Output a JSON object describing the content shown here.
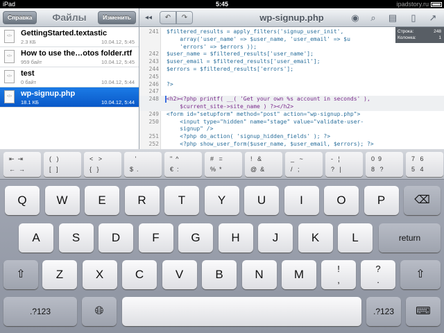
{
  "status": {
    "carrier": "iPad",
    "time": "5:45",
    "watermark": "ipadstory.ru"
  },
  "sidebar": {
    "left_button": "Справка",
    "title": "Файлы",
    "right_button": "Изменить",
    "files": [
      {
        "name": "GettingStarted.textastic",
        "size": "2.3 КБ",
        "date": "10.04.12, 5:45",
        "selected": false
      },
      {
        "name": "How to use the…otos folder.rtf",
        "size": "959 байт",
        "date": "10.04.12, 5:45",
        "selected": false
      },
      {
        "name": "test",
        "size": "0 байт",
        "date": "10.04.12, 5:44",
        "selected": false
      },
      {
        "name": "wp-signup.php",
        "size": "18.1 КБ",
        "date": "10.04.12, 5:44",
        "selected": true
      }
    ]
  },
  "editor": {
    "title": "wp-signup.php",
    "cursor_line_label": "Строка:",
    "cursor_line_value": "248",
    "cursor_col_label": "Колонка:",
    "cursor_col_value": "1",
    "lines": [
      {
        "n": "241",
        "text": "$filtered_results = apply_filters('signup_user_init',"
      },
      {
        "n": "",
        "text": "    array('user_name' => $user_name, 'user_email' => $u"
      },
      {
        "n": "",
        "text": "    'errors' => $errors ));"
      },
      {
        "n": "242",
        "text": "$user_name = $filtered_results['user_name'];"
      },
      {
        "n": "243",
        "text": "$user_email = $filtered_results['user_email'];"
      },
      {
        "n": "244",
        "text": "$errors = $filtered_results['errors'];"
      },
      {
        "n": "245",
        "text": ""
      },
      {
        "n": "246",
        "text": "?>"
      },
      {
        "n": "247",
        "text": ""
      },
      {
        "n": "248",
        "text": "<h2><?php printf( __( 'Get your own %s account in seconds' ),"
      },
      {
        "n": "",
        "text": "    $current_site->site_name ) ?></h2>"
      },
      {
        "n": "249",
        "text": "<form id=\"setupform\" method=\"post\" action=\"wp-signup.php\">"
      },
      {
        "n": "250",
        "text": "    <input type=\"hidden\" name=\"stage\" value=\"validate-user-"
      },
      {
        "n": "",
        "text": "    signup\" />"
      },
      {
        "n": "251",
        "text": "    <?php do_action( 'signup_hidden_fields' ); ?>"
      },
      {
        "n": "252",
        "text": "    <?php show_user_form($user_name, $user_email, $errors); ?>"
      }
    ]
  },
  "extra_keys": [
    {
      "top": "⇤  ⇥",
      "bottom": "←  →"
    },
    {
      "top": "(   )",
      "bottom": "[   ]"
    },
    {
      "top": "<   >",
      "bottom": "{   }"
    },
    {
      "top": "   '",
      "bottom": "$  ."
    },
    {
      "top": "\"  ^",
      "bottom": "€  :"
    },
    {
      "top": "#   =",
      "bottom": "%  *"
    },
    {
      "top": "!   &",
      "bottom": "@  &"
    },
    {
      "top": "_   ~",
      "bottom": "/   ;"
    },
    {
      "top": "-   ¦",
      "bottom": "?   |"
    },
    {
      "top": "0  9",
      "bottom": "8   ?"
    },
    {
      "top": "7   6",
      "bottom": "5   4"
    }
  ],
  "keys": {
    "row1": [
      "Q",
      "W",
      "E",
      "R",
      "T",
      "Y",
      "U",
      "I",
      "O",
      "P"
    ],
    "row2": [
      "A",
      "S",
      "D",
      "F",
      "G",
      "H",
      "J",
      "K",
      "L"
    ],
    "row3": [
      "Z",
      "X",
      "C",
      "V",
      "B",
      "N",
      "M"
    ],
    "return": "return",
    "numbers": ".?123",
    "excl_top": "!",
    "excl_bottom": ",",
    "quest_top": "?",
    "quest_bottom": "."
  }
}
